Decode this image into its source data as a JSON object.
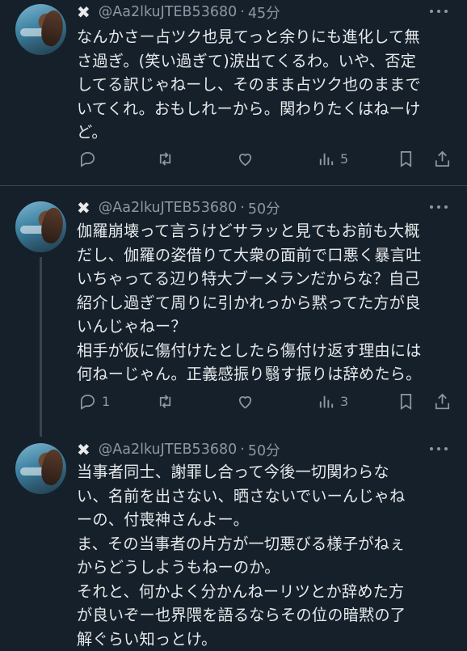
{
  "tweets": [
    {
      "author": "Aa2lkuJTEB53680",
      "time": "45分",
      "text": "なんかさー占ツク也見てっと余りにも進化して無\nさ過ぎ。(笑い過ぎて)涙出てくるわ。いや、否定\nしてる訳じゃねーし、そのまま占ツク也のままで\nいてくれ。おもしれーから。関わりたくはねーけ\nど。",
      "replies": "",
      "views": "5"
    },
    {
      "author": "Aa2lkuJTEB53680",
      "time": "50分",
      "text": "伽羅崩壊って言うけどサラッと見てもお前も大概\nだし、伽羅の姿借りて大衆の面前で口悪く暴言吐\nいちゃってる辺り特大ブーメランだからな？自己\n紹介し過ぎて周りに引かれっから黙ってた方が良\nいんじゃねー？\n相手が仮に傷付けたとしたら傷付け返す理由には\n何ねーじゃん。正義感振り翳す振りは辞めたら。",
      "replies": "1",
      "views": "3"
    },
    {
      "author": "Aa2lkuJTEB53680",
      "time": "50分",
      "text": "当事者同士、謝罪し合って今後一切関わらな\nい、名前を出さない、晒さないでいーんじゃね\nーの、付喪神さんよー。\nま、その当事者の片方が一切悪びる様子がねぇ\nからどうしようもねーのか。\nそれと、何かよく分かんねーリツとか辞めた方\nが良いぞー也界隈を語るならその位の暗黙の了\n解ぐらい知っとけ。"
    }
  ],
  "prefix_mark": "✖",
  "handle_prefix": "@",
  "dot": "·",
  "icons": [
    "reply-icon",
    "retweet-icon",
    "like-icon",
    "views-icon",
    "bookmark-icon",
    "share-icon"
  ],
  "colors": {
    "background": "#15202b",
    "text": "#e7e9ea",
    "muted": "#8b98a5",
    "divider": "#38444d"
  }
}
